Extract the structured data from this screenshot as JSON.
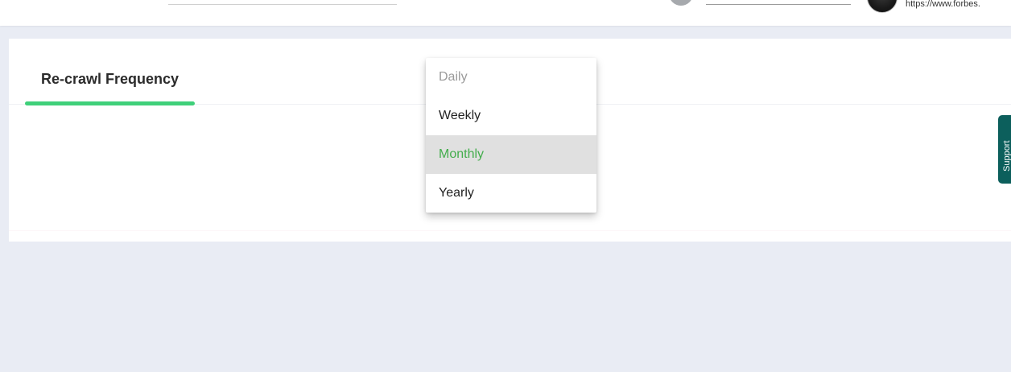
{
  "header": {
    "url_text": "https://www.forbes."
  },
  "tabs": [
    {
      "label": "Re-crawl Frequency",
      "active": true
    }
  ],
  "dropdown": {
    "options": [
      {
        "label": "Daily",
        "disabled": true
      },
      {
        "label": "Weekly"
      },
      {
        "label": "Monthly",
        "selected": true
      },
      {
        "label": "Yearly"
      }
    ],
    "selected_color": "#44ad4d",
    "selected_background": "#e0e0e0"
  },
  "side_tab": {
    "label": "Support"
  },
  "colors": {
    "accent_green": "#3fd07a",
    "background": "#e9ecf4",
    "side_tab": "#0c5f5c"
  }
}
